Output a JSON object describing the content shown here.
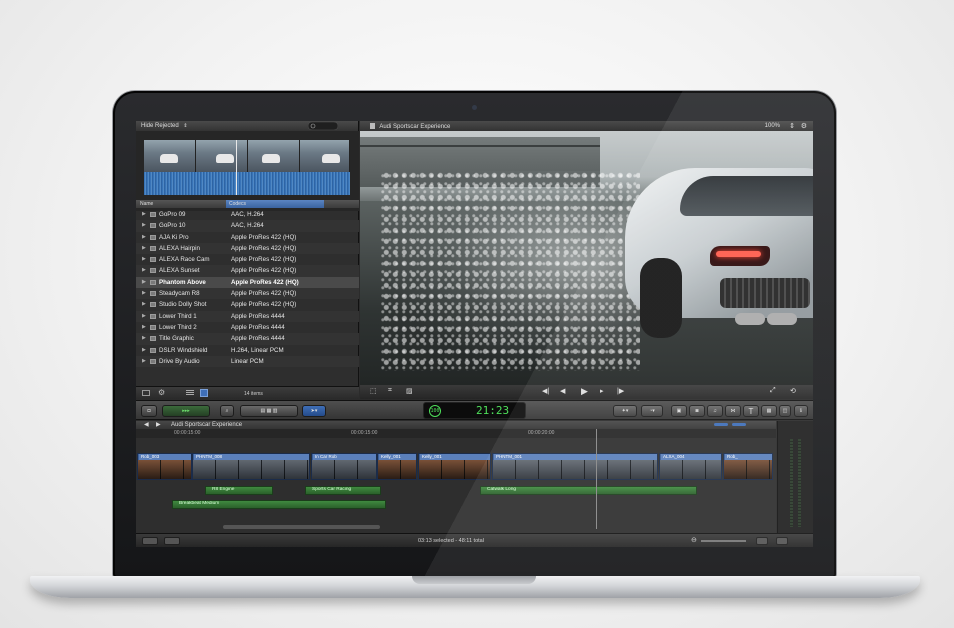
{
  "browser": {
    "filter_label": "Hide Rejected",
    "columns": {
      "name": "Name",
      "codecs": "Codecs"
    },
    "items": [
      {
        "name": "GoPro 09",
        "codec": "AAC, H.264"
      },
      {
        "name": "GoPro 10",
        "codec": "AAC, H.264"
      },
      {
        "name": "AJA Ki Pro",
        "codec": "Apple ProRes 422 (HQ)"
      },
      {
        "name": "ALEXA Hairpin",
        "codec": "Apple ProRes 422 (HQ)"
      },
      {
        "name": "ALEXA Race Cam",
        "codec": "Apple ProRes 422 (HQ)"
      },
      {
        "name": "ALEXA Sunset",
        "codec": "Apple ProRes 422 (HQ)"
      },
      {
        "name": "Phantom Above",
        "codec": "Apple ProRes 422 (HQ)"
      },
      {
        "name": "Steadycam R8",
        "codec": "Apple ProRes 422 (HQ)"
      },
      {
        "name": "Studio Dolly Shot",
        "codec": "Apple ProRes 422 (HQ)"
      },
      {
        "name": "Lower Third 1",
        "codec": "Apple ProRes 4444"
      },
      {
        "name": "Lower Third 2",
        "codec": "Apple ProRes 4444"
      },
      {
        "name": "Title Graphic",
        "codec": "Apple ProRes 4444"
      },
      {
        "name": "DSLR Windshield",
        "codec": "H.264, Linear PCM"
      },
      {
        "name": "Drive By Audio",
        "codec": "Linear PCM"
      }
    ],
    "selected_index": 6,
    "item_count": "14 items"
  },
  "viewer": {
    "title": "Audi Sportscar Experience",
    "zoom": "100%"
  },
  "toolbar": {
    "timecode": "21:23",
    "timecode_mode": "100"
  },
  "timeline": {
    "project_title": "Audi Sportscar Experience",
    "ruler": [
      "00:00:15:00",
      "00:00:15:00",
      "00:00:20:00"
    ],
    "clips": [
      {
        "label": "Rob_003",
        "kind": "person"
      },
      {
        "label": "PHNTM_008",
        "kind": "car"
      },
      {
        "label": "In Car Rob",
        "kind": "car"
      },
      {
        "label": "Kelly_001",
        "kind": "person"
      },
      {
        "label": "Kelly_001",
        "kind": "person"
      },
      {
        "label": "PHNTM_001",
        "kind": "car"
      },
      {
        "label": "ALXA_004",
        "kind": "car"
      },
      {
        "label": "Rob_",
        "kind": "person"
      }
    ],
    "audio": [
      {
        "label": "R8 Engine"
      },
      {
        "label": "Sports Car Racing"
      },
      {
        "label": "Catwalk Long"
      },
      {
        "label": "Breakbeat Medium"
      }
    ]
  },
  "status": {
    "summary": "03:13 selected - 48:11 total"
  },
  "colors": {
    "timecode_green": "#4ee05a",
    "video_clip": "#3a5f98",
    "audio_clip": "#3f8a3f"
  }
}
